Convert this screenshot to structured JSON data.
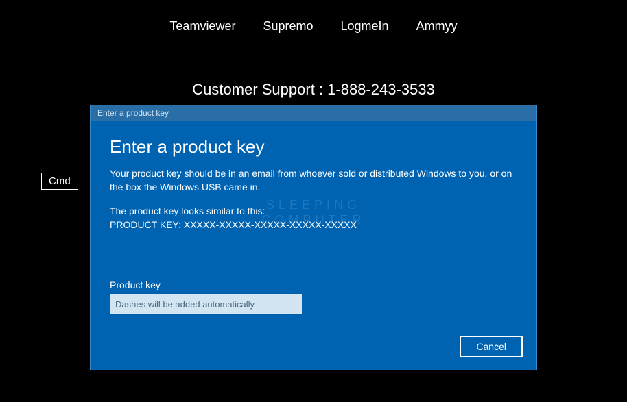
{
  "nav": {
    "items": [
      "Teamviewer",
      "Supremo",
      "LogmeIn",
      "Ammyy"
    ]
  },
  "support": {
    "text": "Customer Support : 1-888-243-3533"
  },
  "cmd": {
    "label": "Cmd"
  },
  "dialog": {
    "titlebar": "Enter a product key",
    "heading": "Enter a product key",
    "description": "Your product key should be in an email from whoever sold or distributed Windows to you, or on the box the Windows USB came in.",
    "example_intro": "The product key looks similar to this:",
    "example_key": "PRODUCT KEY: XXXXX-XXXXX-XXXXX-XXXXX-XXXXX",
    "field_label": "Product key",
    "input_placeholder": "Dashes will be added automatically",
    "input_value": "",
    "cancel_label": "Cancel"
  },
  "watermark": {
    "line1": "SLEEPING",
    "line2": "COMPUTER"
  }
}
